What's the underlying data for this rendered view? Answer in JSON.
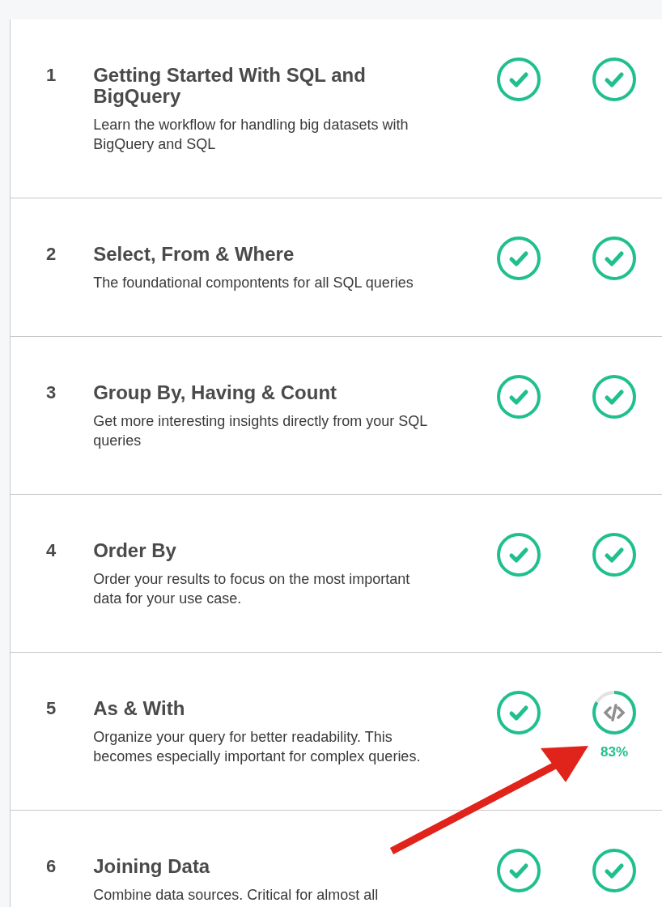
{
  "lessons": [
    {
      "number": "1",
      "title": "Getting Started With SQL and BigQuery",
      "description": "Learn the workflow for handling big datasets with BigQuery and SQL",
      "steps": [
        {
          "kind": "done"
        },
        {
          "kind": "done"
        }
      ]
    },
    {
      "number": "2",
      "title": "Select, From & Where",
      "description": "The foundational compontents for all SQL queries",
      "steps": [
        {
          "kind": "done"
        },
        {
          "kind": "done"
        }
      ]
    },
    {
      "number": "3",
      "title": "Group By, Having & Count",
      "description": "Get more interesting insights directly from your SQL queries",
      "steps": [
        {
          "kind": "done"
        },
        {
          "kind": "done"
        }
      ]
    },
    {
      "number": "4",
      "title": "Order By",
      "description": "Order your results to focus on the most important data for your use case.",
      "steps": [
        {
          "kind": "done"
        },
        {
          "kind": "done"
        }
      ]
    },
    {
      "number": "5",
      "title": "As & With",
      "description": "Organize your query for better readability. This becomes especially important for complex queries.",
      "steps": [
        {
          "kind": "done"
        },
        {
          "kind": "progress",
          "level": 0.83,
          "reading": "83%"
        }
      ]
    },
    {
      "number": "6",
      "title": "Joining Data",
      "description": "Combine data sources. Critical for almost all",
      "steps": [
        {
          "kind": "done"
        },
        {
          "kind": "done"
        }
      ]
    }
  ]
}
